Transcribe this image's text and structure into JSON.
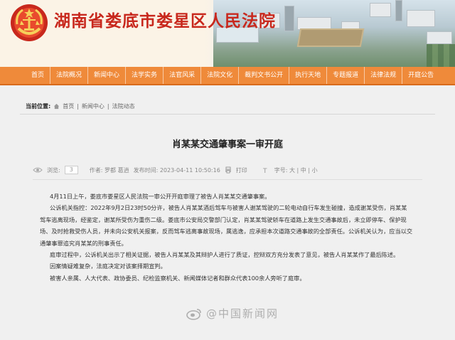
{
  "site": {
    "title": "湖南省娄底市娄星区人民法院"
  },
  "nav": {
    "items": [
      "首页",
      "法院概况",
      "新闻中心",
      "法学实务",
      "法官风采",
      "法院文化",
      "裁判文书公开",
      "执行天地",
      "专题报道",
      "法律法规",
      "开庭公告"
    ]
  },
  "breadcrumb": {
    "label": "当前位置:",
    "items": [
      "首页",
      "新闻中心",
      "法院动态"
    ],
    "separator": "|"
  },
  "article": {
    "title": "肖某某交通肇事案一审开庭",
    "meta": {
      "count": "3",
      "author": "作者: 罗都 葛逍",
      "published": "发布时间: 2023-04-11 10:50:16",
      "print": "打印",
      "font_size_label": "字号: 大 | 中 | 小"
    },
    "paragraphs": [
      "4月11日上午，娄底市娄星区人民法院一审公开开庭审理了被告人肖某某交通肇事案。",
      "公诉机关指控：2022年9月2日23时50分许，被告人肖某某酒后驾车与被害人谢某驾驶的二轮电动自行车发生碰撞，造成谢某受伤，肖某某驾车逃离现场，经鉴定，谢某所受伤为重伤二级。娄底市公安局交警部门认定，肖某某驾驶轿车在道路上发生交通事故后，未立即停车、保护现场、及时抢救受伤人员，并未向公安机关报案，反而驾车逃离事故现场，属逃逸，应承担本次道路交通事故的全部责任。公诉机关认为，应当以交通肇事罪追究肖某某的刑事责任。",
      "庭审过程中，公诉机关出示了相关证据，被告人肖某某及其辩护人进行了质证，控辩双方充分发表了意见，被告人肖某某作了最后陈述。",
      "因案情疑难复杂，法庭决定对该案择期宣判。",
      "被害人亲属、人大代表、政协委员、纪检监察机关、新闻媒体记者和群众代表100余人旁听了庭审。"
    ]
  },
  "watermark": {
    "text": "@中国新闻网"
  }
}
